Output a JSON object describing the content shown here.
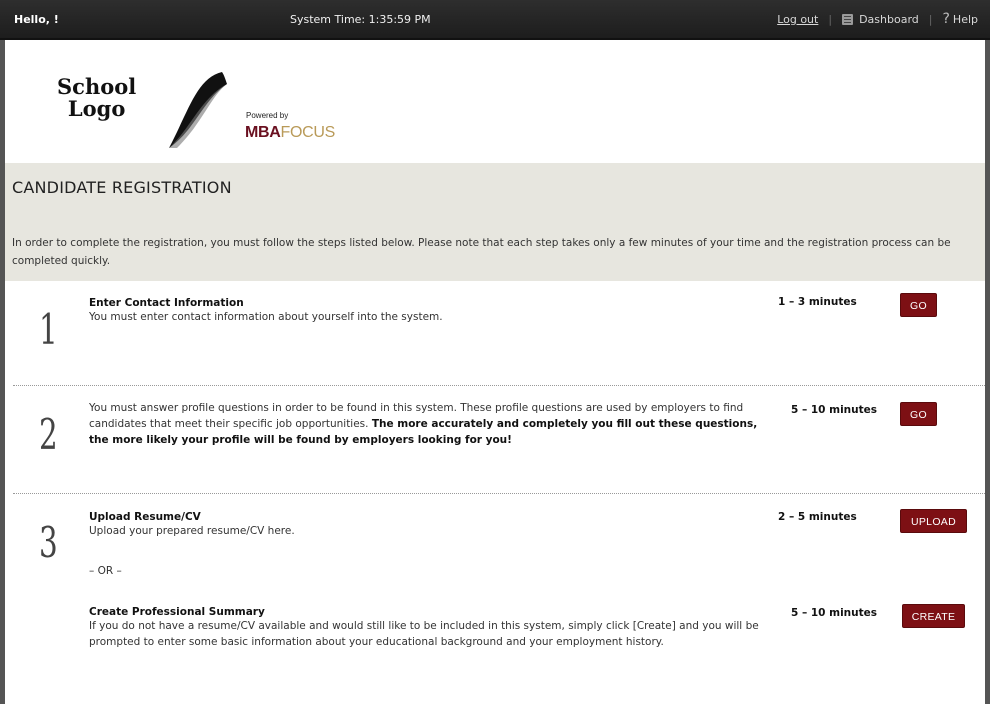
{
  "topbar": {
    "greeting": "Hello, !",
    "system_time": "System Time: 1:35:59 PM",
    "logout": "Log out",
    "dashboard": "Dashboard",
    "help": "Help",
    "help_glyph": "?"
  },
  "logo": {
    "school_line1": "School",
    "school_line2": "Logo",
    "powered_by": "Powered by",
    "brand_mba": "MBA",
    "brand_focus": "FOCUS"
  },
  "page": {
    "title": "CANDIDATE REGISTRATION",
    "intro": "In order to complete the registration, you must follow the steps listed below. Please note that each step takes only a few minutes of your time and the registration process can be completed quickly."
  },
  "steps": [
    {
      "number": "1",
      "title": "Enter Contact Information",
      "text": "You must enter contact information about yourself into the system.",
      "duration": "1 – 3 minutes",
      "button": "GO"
    },
    {
      "number": "2",
      "text": "You must answer profile questions in order to be found in this system.  These profile questions are used by employers to find candidates that meet their specific job opportunities.",
      "text_bold": "The more accurately and completely you fill out these questions, the more likely your profile will be found by employers looking for you!",
      "duration": "5 – 10 minutes",
      "button": "GO"
    },
    {
      "number": "3",
      "title": "Upload Resume/CV",
      "text": "Upload your prepared resume/CV here.",
      "duration": "2 – 5 minutes",
      "button": "UPLOAD",
      "or_text": "– OR –",
      "alt_title": "Create Professional Summary",
      "alt_text": "If you do not have a resume/CV available and would still like to be included in this system, simply click [Create] and you will be prompted to enter some basic information about your educational background and your employment history.",
      "alt_duration": "5 – 10 minutes",
      "alt_button": "CREATE"
    }
  ],
  "colors": {
    "topbar_bg": "#262626",
    "header_band": "#e7e6df",
    "button_bg": "#7d1014",
    "brand_mba": "#6a1020",
    "brand_focus": "#b99a58"
  },
  "icons": [
    "dashboard-icon",
    "help-icon"
  ]
}
